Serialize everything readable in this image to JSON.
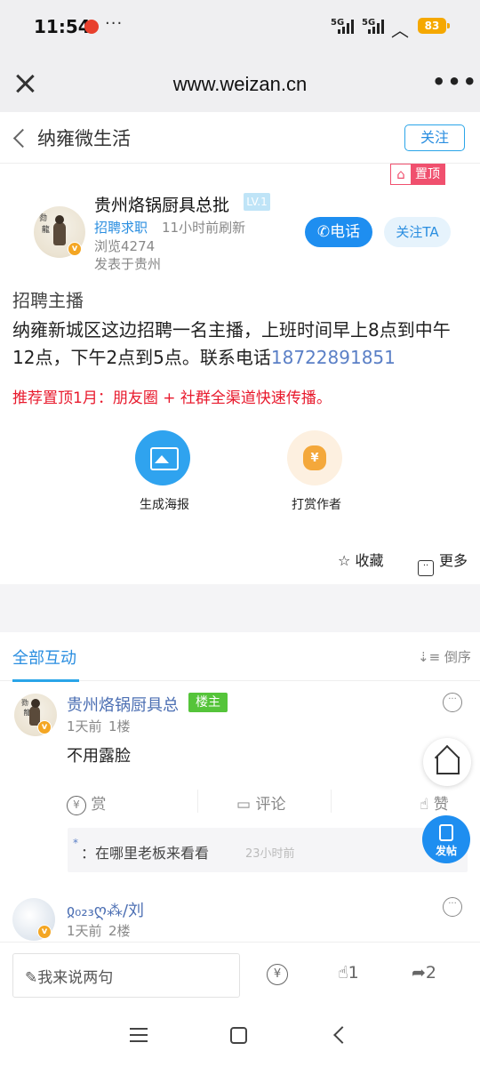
{
  "status_bar": {
    "time": "11:54",
    "notification_dots": "···",
    "signal1": "5G",
    "signal2": "5G",
    "battery": "83"
  },
  "browser": {
    "url": "www.weizan.cn"
  },
  "site_nav": {
    "title": "纳雍微生活",
    "follow_label": "关注"
  },
  "post": {
    "pin_label": "置顶",
    "author": "贵州烙锅厨具总批",
    "level": "LV.1",
    "category": "招聘求职",
    "refreshed": "11小时前刷新",
    "views": "浏览4274",
    "posted_from": "发表于贵州",
    "call_label": "电话",
    "follow_user_label": "关注TA",
    "title": "招聘主播",
    "body": "纳雍新城区这边招聘一名主播，上班时间早上8点到中午12点，下午2点到5点。联系电话",
    "phone": "18722891851",
    "promo": "推荐置顶1月：朋友圈 + 社群全渠道快速传播。",
    "actions": {
      "poster_label": "生成海报",
      "tip_label": "打赏作者",
      "tip_symbol": "¥",
      "favorite_label": "收藏",
      "more_label": "更多"
    }
  },
  "interactions": {
    "tab_label": "全部互动",
    "sort_label": "倒序",
    "comments": [
      {
        "name": "贵州烙锅厨具总",
        "badge": "楼主",
        "meta_time": "1天前",
        "meta_floor": "1楼",
        "text": "不用露脸",
        "reward_label": "赏",
        "comment_label": "评论",
        "like_label": "赞",
        "reply": {
          "author": "*",
          "text": "：在哪里老板来看看",
          "time": "23小时前"
        }
      },
      {
        "name": "ჲ₀₂₃ღ⁂/刘",
        "meta_time": "1天前",
        "meta_floor": "2楼"
      }
    ]
  },
  "float": {
    "post_label": "发帖"
  },
  "bottom_bar": {
    "input_placeholder": "我来说两句",
    "reward_symbol": "¥",
    "like_count": "1",
    "share_count": "2"
  },
  "colors": {
    "accent": "#2a8ee0",
    "promo_red": "#e8192c",
    "host_green": "#55c43a",
    "pin_pink": "#f0506e"
  }
}
